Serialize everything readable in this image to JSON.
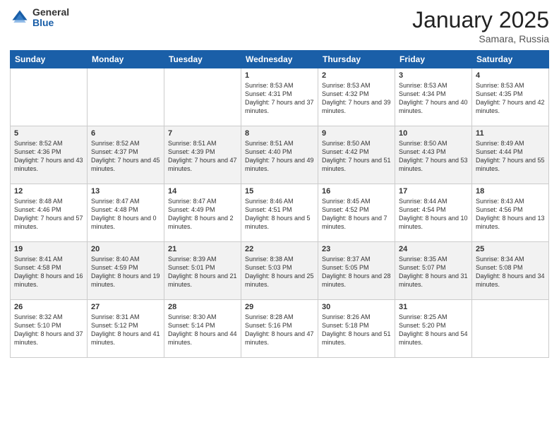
{
  "logo": {
    "general": "General",
    "blue": "Blue"
  },
  "header": {
    "month": "January 2025",
    "location": "Samara, Russia"
  },
  "weekdays": [
    "Sunday",
    "Monday",
    "Tuesday",
    "Wednesday",
    "Thursday",
    "Friday",
    "Saturday"
  ],
  "weeks": [
    [
      {
        "day": "",
        "sunrise": "",
        "sunset": "",
        "daylight": ""
      },
      {
        "day": "",
        "sunrise": "",
        "sunset": "",
        "daylight": ""
      },
      {
        "day": "",
        "sunrise": "",
        "sunset": "",
        "daylight": ""
      },
      {
        "day": "1",
        "sunrise": "Sunrise: 8:53 AM",
        "sunset": "Sunset: 4:31 PM",
        "daylight": "Daylight: 7 hours and 37 minutes."
      },
      {
        "day": "2",
        "sunrise": "Sunrise: 8:53 AM",
        "sunset": "Sunset: 4:32 PM",
        "daylight": "Daylight: 7 hours and 39 minutes."
      },
      {
        "day": "3",
        "sunrise": "Sunrise: 8:53 AM",
        "sunset": "Sunset: 4:34 PM",
        "daylight": "Daylight: 7 hours and 40 minutes."
      },
      {
        "day": "4",
        "sunrise": "Sunrise: 8:53 AM",
        "sunset": "Sunset: 4:35 PM",
        "daylight": "Daylight: 7 hours and 42 minutes."
      }
    ],
    [
      {
        "day": "5",
        "sunrise": "Sunrise: 8:52 AM",
        "sunset": "Sunset: 4:36 PM",
        "daylight": "Daylight: 7 hours and 43 minutes."
      },
      {
        "day": "6",
        "sunrise": "Sunrise: 8:52 AM",
        "sunset": "Sunset: 4:37 PM",
        "daylight": "Daylight: 7 hours and 45 minutes."
      },
      {
        "day": "7",
        "sunrise": "Sunrise: 8:51 AM",
        "sunset": "Sunset: 4:39 PM",
        "daylight": "Daylight: 7 hours and 47 minutes."
      },
      {
        "day": "8",
        "sunrise": "Sunrise: 8:51 AM",
        "sunset": "Sunset: 4:40 PM",
        "daylight": "Daylight: 7 hours and 49 minutes."
      },
      {
        "day": "9",
        "sunrise": "Sunrise: 8:50 AM",
        "sunset": "Sunset: 4:42 PM",
        "daylight": "Daylight: 7 hours and 51 minutes."
      },
      {
        "day": "10",
        "sunrise": "Sunrise: 8:50 AM",
        "sunset": "Sunset: 4:43 PM",
        "daylight": "Daylight: 7 hours and 53 minutes."
      },
      {
        "day": "11",
        "sunrise": "Sunrise: 8:49 AM",
        "sunset": "Sunset: 4:44 PM",
        "daylight": "Daylight: 7 hours and 55 minutes."
      }
    ],
    [
      {
        "day": "12",
        "sunrise": "Sunrise: 8:48 AM",
        "sunset": "Sunset: 4:46 PM",
        "daylight": "Daylight: 7 hours and 57 minutes."
      },
      {
        "day": "13",
        "sunrise": "Sunrise: 8:47 AM",
        "sunset": "Sunset: 4:48 PM",
        "daylight": "Daylight: 8 hours and 0 minutes."
      },
      {
        "day": "14",
        "sunrise": "Sunrise: 8:47 AM",
        "sunset": "Sunset: 4:49 PM",
        "daylight": "Daylight: 8 hours and 2 minutes."
      },
      {
        "day": "15",
        "sunrise": "Sunrise: 8:46 AM",
        "sunset": "Sunset: 4:51 PM",
        "daylight": "Daylight: 8 hours and 5 minutes."
      },
      {
        "day": "16",
        "sunrise": "Sunrise: 8:45 AM",
        "sunset": "Sunset: 4:52 PM",
        "daylight": "Daylight: 8 hours and 7 minutes."
      },
      {
        "day": "17",
        "sunrise": "Sunrise: 8:44 AM",
        "sunset": "Sunset: 4:54 PM",
        "daylight": "Daylight: 8 hours and 10 minutes."
      },
      {
        "day": "18",
        "sunrise": "Sunrise: 8:43 AM",
        "sunset": "Sunset: 4:56 PM",
        "daylight": "Daylight: 8 hours and 13 minutes."
      }
    ],
    [
      {
        "day": "19",
        "sunrise": "Sunrise: 8:41 AM",
        "sunset": "Sunset: 4:58 PM",
        "daylight": "Daylight: 8 hours and 16 minutes."
      },
      {
        "day": "20",
        "sunrise": "Sunrise: 8:40 AM",
        "sunset": "Sunset: 4:59 PM",
        "daylight": "Daylight: 8 hours and 19 minutes."
      },
      {
        "day": "21",
        "sunrise": "Sunrise: 8:39 AM",
        "sunset": "Sunset: 5:01 PM",
        "daylight": "Daylight: 8 hours and 21 minutes."
      },
      {
        "day": "22",
        "sunrise": "Sunrise: 8:38 AM",
        "sunset": "Sunset: 5:03 PM",
        "daylight": "Daylight: 8 hours and 25 minutes."
      },
      {
        "day": "23",
        "sunrise": "Sunrise: 8:37 AM",
        "sunset": "Sunset: 5:05 PM",
        "daylight": "Daylight: 8 hours and 28 minutes."
      },
      {
        "day": "24",
        "sunrise": "Sunrise: 8:35 AM",
        "sunset": "Sunset: 5:07 PM",
        "daylight": "Daylight: 8 hours and 31 minutes."
      },
      {
        "day": "25",
        "sunrise": "Sunrise: 8:34 AM",
        "sunset": "Sunset: 5:08 PM",
        "daylight": "Daylight: 8 hours and 34 minutes."
      }
    ],
    [
      {
        "day": "26",
        "sunrise": "Sunrise: 8:32 AM",
        "sunset": "Sunset: 5:10 PM",
        "daylight": "Daylight: 8 hours and 37 minutes."
      },
      {
        "day": "27",
        "sunrise": "Sunrise: 8:31 AM",
        "sunset": "Sunset: 5:12 PM",
        "daylight": "Daylight: 8 hours and 41 minutes."
      },
      {
        "day": "28",
        "sunrise": "Sunrise: 8:30 AM",
        "sunset": "Sunset: 5:14 PM",
        "daylight": "Daylight: 8 hours and 44 minutes."
      },
      {
        "day": "29",
        "sunrise": "Sunrise: 8:28 AM",
        "sunset": "Sunset: 5:16 PM",
        "daylight": "Daylight: 8 hours and 47 minutes."
      },
      {
        "day": "30",
        "sunrise": "Sunrise: 8:26 AM",
        "sunset": "Sunset: 5:18 PM",
        "daylight": "Daylight: 8 hours and 51 minutes."
      },
      {
        "day": "31",
        "sunrise": "Sunrise: 8:25 AM",
        "sunset": "Sunset: 5:20 PM",
        "daylight": "Daylight: 8 hours and 54 minutes."
      },
      {
        "day": "",
        "sunrise": "",
        "sunset": "",
        "daylight": ""
      }
    ]
  ]
}
